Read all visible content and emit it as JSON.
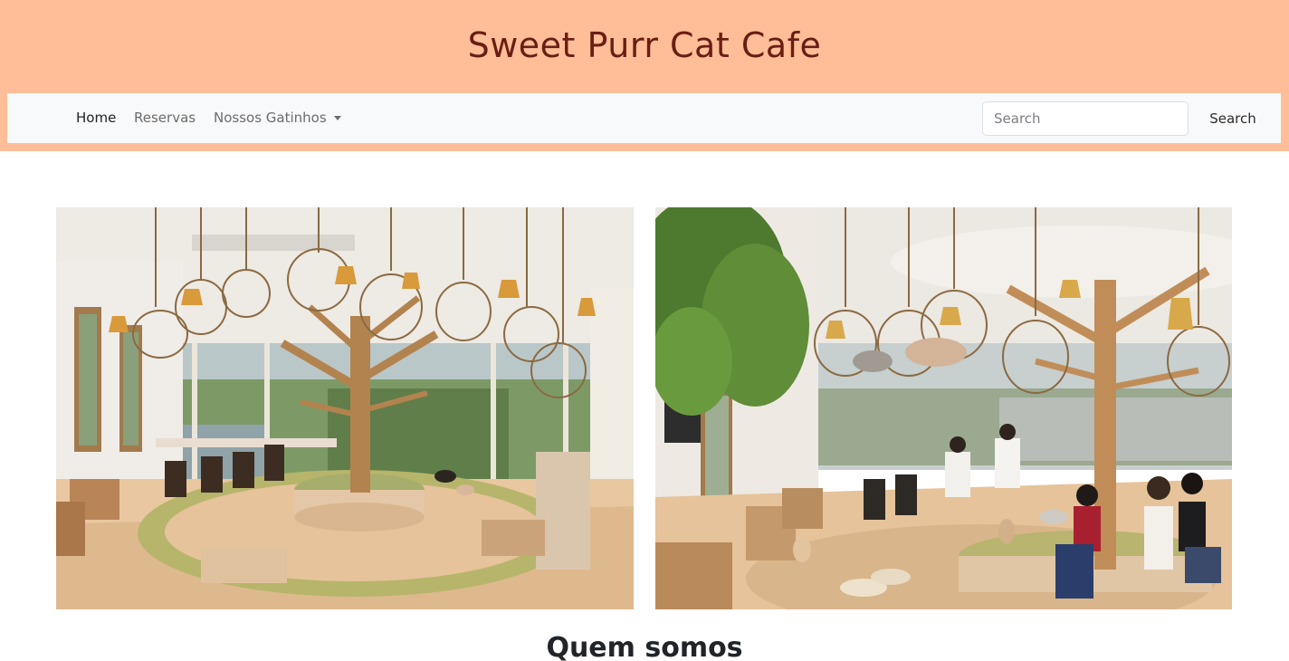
{
  "header": {
    "title": "Sweet Purr Cat Cafe"
  },
  "nav": {
    "items": [
      {
        "label": "Home",
        "active": true
      },
      {
        "label": "Reservas",
        "active": false
      },
      {
        "label": "Nossos Gatinhos",
        "active": false,
        "dropdown": true
      }
    ]
  },
  "search": {
    "placeholder": "Search",
    "value": "",
    "button_label": "Search"
  },
  "gallery": {
    "images": [
      {
        "name": "cafe-interior-tree-cages"
      },
      {
        "name": "cafe-interior-visitors-cats"
      }
    ]
  },
  "about": {
    "heading": "Quem somos"
  },
  "colors": {
    "header_bg": "#ffbe98",
    "title_color": "#6b1d14",
    "navbar_bg": "#f8f9fa"
  }
}
